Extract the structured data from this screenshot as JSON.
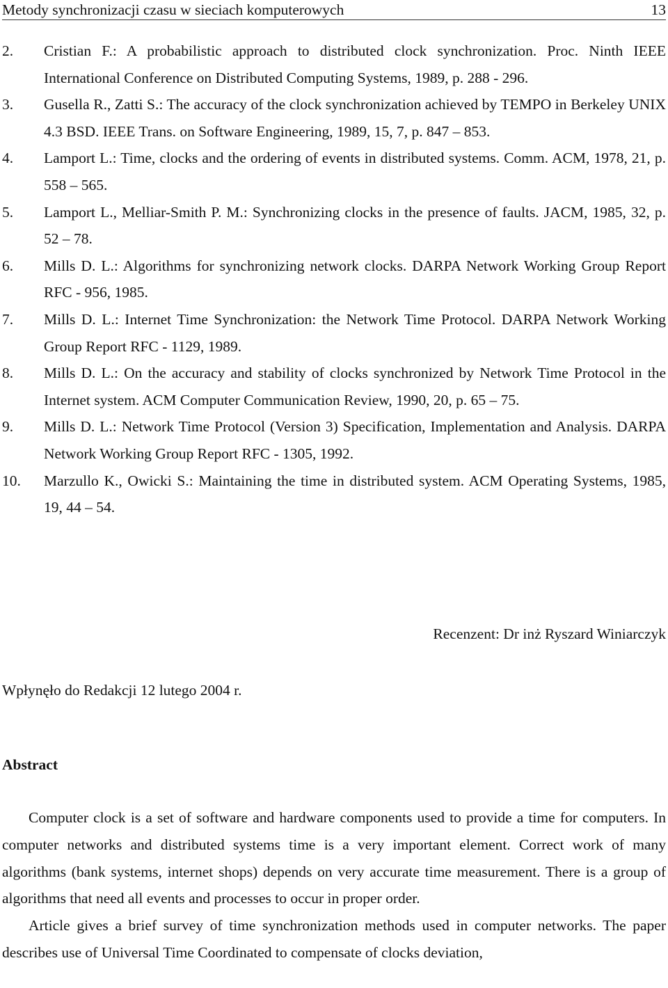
{
  "header": {
    "running_title": "Metody synchronizacji czasu w sieciach komputerowych",
    "page_number": "13"
  },
  "references": [
    {
      "number": "2.",
      "text": "Cristian F.: A probabilistic approach to distributed clock synchronization. Proc. Ninth IEEE International Conference on Distributed Computing Systems, 1989, p. 288 - 296."
    },
    {
      "number": "3.",
      "text": "Gusella R., Zatti S.: The accuracy of the clock synchronization achieved by TEMPO in Berkeley UNIX 4.3 BSD. IEEE Trans. on Software Engineering, 1989, 15, 7, p. 847 – 853."
    },
    {
      "number": "4.",
      "text": "Lamport L.: Time, clocks and the ordering of events in distributed systems. Comm. ACM, 1978, 21, p. 558 – 565."
    },
    {
      "number": "5.",
      "text": "Lamport L., Melliar-Smith P. M.: Synchronizing clocks in the presence of faults. JACM, 1985, 32, p. 52 – 78."
    },
    {
      "number": "6.",
      "text": "Mills D. L.: Algorithms for synchronizing network clocks. DARPA Network Working Group Report RFC - 956, 1985."
    },
    {
      "number": "7.",
      "text": "Mills D. L.: Internet Time Synchronization: the Network Time Protocol. DARPA Network Working Group Report RFC - 1129, 1989."
    },
    {
      "number": "8.",
      "text": "Mills D. L.: On the accuracy and stability of clocks synchronized by Network Time Protocol in the Internet system. ACM Computer Communication Review, 1990, 20, p. 65 – 75."
    },
    {
      "number": "9.",
      "text": "Mills D. L.: Network Time Protocol (Version 3) Specification, Implementation and Analysis. DARPA Network Working Group Report RFC - 1305, 1992."
    },
    {
      "number": "10.",
      "text": "Marzullo K., Owicki S.: Maintaining the time in distributed system. ACM Operating Systems, 1985, 19, 44 – 54."
    }
  ],
  "reviewer": "Recenzent: Dr inż Ryszard Winiarczyk",
  "received": "Wpłynęło do Redakcji 12 lutego 2004 r.",
  "abstract": {
    "heading": "Abstract",
    "paragraphs": [
      "Computer clock is a set of software and hardware components used to provide a time for computers. In computer networks and distributed systems time is a very important element. Correct work of many algorithms (bank systems, internet shops) depends on very accurate time measurement. There is a group of algorithms that need all events and processes to occur in proper order.",
      "Article gives a brief survey of time synchronization methods used in computer networks. The paper describes use of Universal Time Coordinated to compensate of clocks deviation,"
    ]
  }
}
